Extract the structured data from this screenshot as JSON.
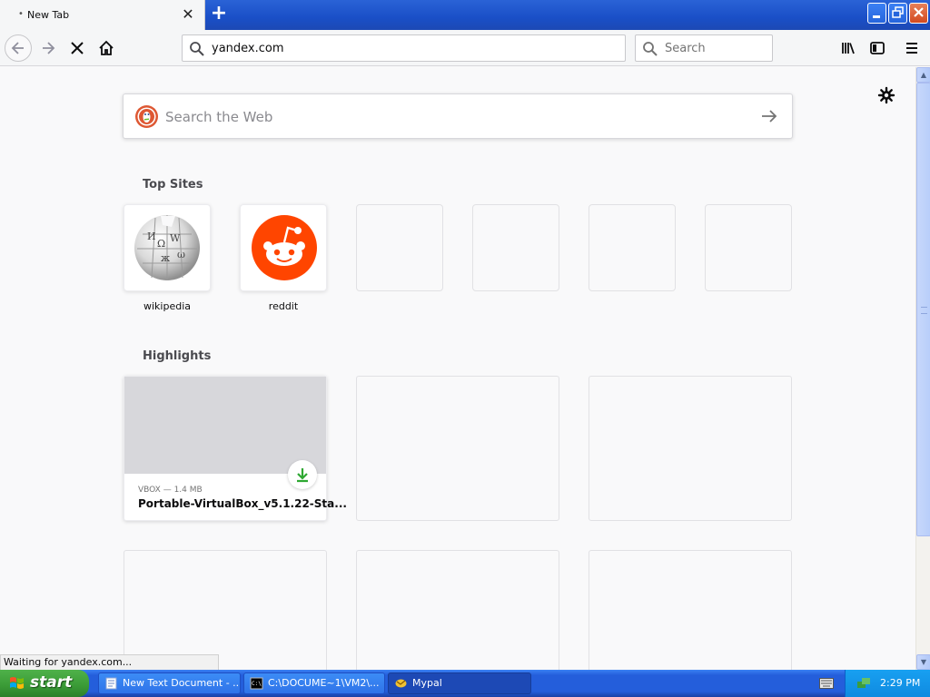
{
  "browser": {
    "tab": {
      "title": "New Tab"
    },
    "url": "yandex.com",
    "search_placeholder": "Search"
  },
  "newtab": {
    "websearch_placeholder": "Search the Web",
    "topsites_title": "Top Sites",
    "topsites": [
      {
        "label": "wikipedia",
        "icon": "wikipedia-globe-icon"
      },
      {
        "label": "reddit",
        "icon": "reddit-alien-icon"
      }
    ],
    "highlights_title": "Highlights",
    "highlight_card": {
      "meta": "VBOX — 1.4 MB",
      "name": "Portable-VirtualBox_v5.1.22-Sta..."
    }
  },
  "status_text": "Waiting for yandex.com...",
  "taskbar": {
    "start_label": "start",
    "tasks": [
      {
        "label": "New Text Document - ...",
        "icon": "notepad-icon"
      },
      {
        "label": "C:\\DOCUME~1\\VM2\\...",
        "icon": "cmd-icon"
      },
      {
        "label": "Mypal",
        "icon": "mypal-icon"
      }
    ],
    "clock": "2:29 PM"
  },
  "colors": {
    "reddit": "#ff4500",
    "duckduckgo": "#de5833",
    "download_green": "#2ea832",
    "xp_blue": "#245edb",
    "start_green": "#3a9a36"
  }
}
